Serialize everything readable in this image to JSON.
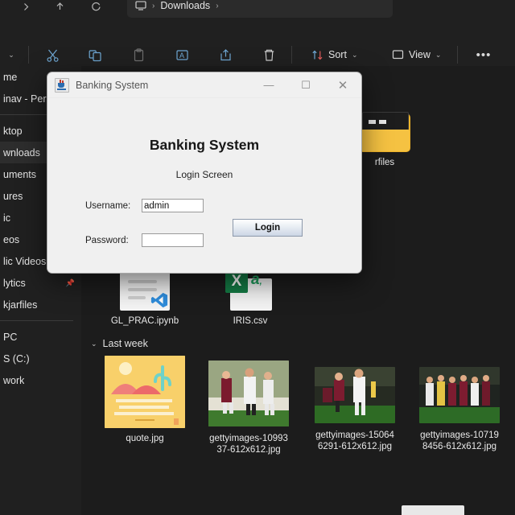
{
  "explorer": {
    "nav": {
      "forward_icon": "chevron-right-icon",
      "up_icon": "arrow-up-icon",
      "refresh_icon": "refresh-icon",
      "breadcrumb": {
        "root_icon": "this-pc-icon",
        "sep": "›",
        "current": "Downloads",
        "trailing_sep": "›"
      }
    },
    "toolbar": {
      "new_caret": "⌄",
      "items": [
        {
          "name": "cut",
          "icon": "scissors-icon"
        },
        {
          "name": "copy",
          "icon": "copy-icon"
        },
        {
          "name": "paste",
          "icon": "clipboard-icon"
        },
        {
          "name": "rename",
          "icon": "rename-icon"
        },
        {
          "name": "share",
          "icon": "share-icon"
        },
        {
          "name": "delete",
          "icon": "trash-icon"
        }
      ],
      "sort_label": "Sort",
      "sort_icon": "sort-arrows-icon",
      "view_label": "View",
      "view_icon": "view-monitor-icon",
      "more_label": "•••",
      "caret": "⌄"
    },
    "sidebar": {
      "items": [
        {
          "label": "me",
          "full": "Home",
          "selected": false,
          "pinned": false
        },
        {
          "label": "inav - Pers",
          "full": "OneDrive - Personal",
          "selected": false,
          "pinned": false
        },
        {
          "sep": true
        },
        {
          "label": "ktop",
          "full": "Desktop",
          "selected": false,
          "pinned": true
        },
        {
          "label": "wnloads",
          "full": "Downloads",
          "selected": true,
          "pinned": true
        },
        {
          "label": "uments",
          "full": "Documents",
          "selected": false,
          "pinned": true
        },
        {
          "label": "ures",
          "full": "Pictures",
          "selected": false,
          "pinned": true
        },
        {
          "label": "ic",
          "full": "Music",
          "selected": false,
          "pinned": true
        },
        {
          "label": "eos",
          "full": "Videos",
          "selected": false,
          "pinned": true
        },
        {
          "label": "lic Videos",
          "full": "Public Videos",
          "selected": false,
          "pinned": false
        },
        {
          "label": "lytics",
          "full": "Analytics",
          "selected": false,
          "pinned": true
        },
        {
          "label": "kjarfiles",
          "full": "checkjarfiles",
          "selected": false,
          "pinned": false
        },
        {
          "sep": true
        },
        {
          "label": "PC",
          "full": "This PC",
          "selected": false,
          "pinned": false
        },
        {
          "label": "S (C:)",
          "full": "Windows (C:)",
          "selected": false,
          "pinned": false
        },
        {
          "label": "work",
          "full": "Network",
          "selected": false,
          "pinned": false
        }
      ],
      "pin_icon": "pin-icon"
    },
    "content": {
      "groups": [
        {
          "label": "Last week",
          "chevron": "⌄"
        }
      ],
      "files": [
        {
          "name": "jarfiles",
          "label": "rfiles",
          "type": "folder"
        },
        {
          "name": "GL_PRAC.ipynb",
          "label": "GL_PRAC.ipynb",
          "type": "notebook"
        },
        {
          "name": "IRIS.csv",
          "label": "IRIS.csv",
          "type": "csv"
        },
        {
          "name": "quote.jpg",
          "label": "quote.jpg",
          "type": "image-quote"
        },
        {
          "name": "gettyimages-1099337-612x612.jpg",
          "label": "gettyimages-1099337-612x612.jpg",
          "type": "image-photo"
        },
        {
          "name": "gettyimages-150646291-612x612.jpg",
          "label": "gettyimages-150646291-612x612.jpg",
          "type": "image-photo"
        },
        {
          "name": "gettyimages-107198456-612x612.jpg",
          "label": "gettyimages-107198456-612x612.jpg",
          "type": "image-photo"
        }
      ],
      "quote_thumb_text": "\"Act as if what you do makes a difference. It does.\""
    }
  },
  "dialog": {
    "title": "Banking System",
    "app_icon": "java-coffee-cup-icon",
    "window_controls": {
      "minimize": "—",
      "maximize": "☐",
      "close": "✕"
    },
    "heading": "Banking System",
    "subheading": "Login Screen",
    "fields": {
      "username_label": "Username:",
      "username_value": "admin",
      "password_label": "Password:",
      "password_value": ""
    },
    "login_button": "Login"
  },
  "colors": {
    "explorer_bg": "#1c1c1c",
    "chrome_bg": "#202020",
    "accent_blue": "#5aa0d6",
    "folder_yellow": "#f0b429",
    "dialog_bg": "#f0f0f0",
    "button_blue": "#ccd6e5"
  }
}
